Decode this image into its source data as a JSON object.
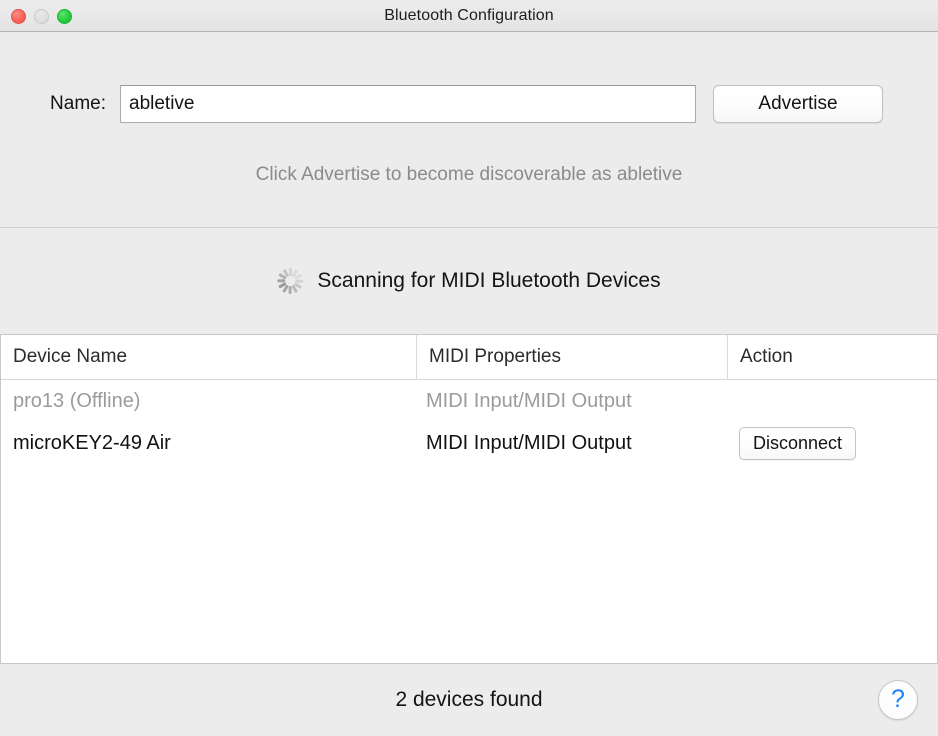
{
  "window": {
    "title": "Bluetooth Configuration",
    "traffic_lights": [
      {
        "name": "close",
        "color": "#fa6359",
        "enabled": true
      },
      {
        "name": "minimize",
        "color": "#e0e0e0",
        "enabled": false
      },
      {
        "name": "zoom",
        "color": "#27cd41",
        "enabled": true
      }
    ]
  },
  "local_device": {
    "name_label": "Name:",
    "name_value": "abletive",
    "name_placeholder": "Name",
    "advertise_label": "Advertise",
    "hint": "Click Advertise to become discoverable as abletive"
  },
  "scanning": {
    "icon": "spinner-icon",
    "label": "Scanning for MIDI Bluetooth Devices",
    "active": true
  },
  "device_table": {
    "columns": [
      {
        "key": "device_name",
        "label": "Device Name"
      },
      {
        "key": "midi_properties",
        "label": "MIDI Properties"
      },
      {
        "key": "action",
        "label": "Action"
      }
    ],
    "rows": [
      {
        "device_name": "pro13 (Offline)",
        "midi_properties": "MIDI Input/MIDI Output",
        "action_label": "",
        "state": "offline"
      },
      {
        "device_name": "microKEY2-49 Air",
        "midi_properties": "MIDI Input/MIDI Output",
        "action_label": "Disconnect",
        "state": "online"
      }
    ]
  },
  "footer": {
    "status": "2 devices found",
    "help_label": "?"
  },
  "colors": {
    "window_background": "#ececec",
    "table_background": "#ffffff",
    "text_primary": "#141414",
    "text_disabled": "#9b9b9b",
    "hint_text": "#8b8b8b",
    "help_accent": "#1a82ff",
    "divider": "#cfcfcf"
  }
}
